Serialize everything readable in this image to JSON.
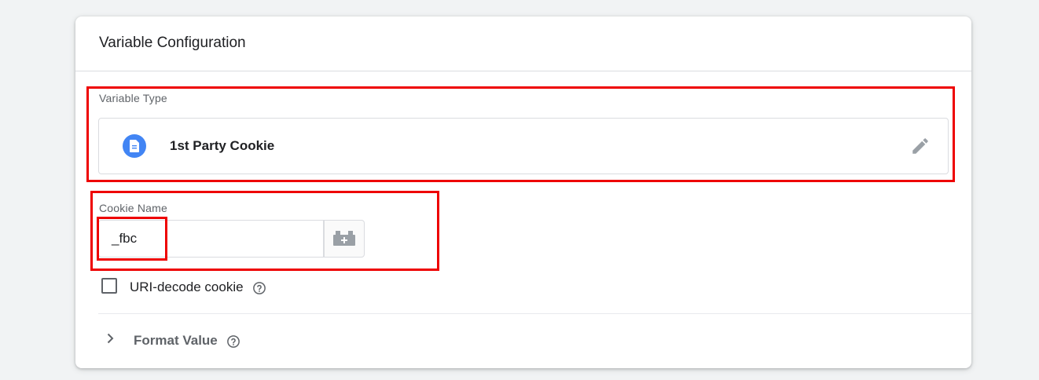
{
  "card": {
    "title": "Variable Configuration"
  },
  "variable_type": {
    "label": "Variable Type",
    "name": "1st Party Cookie",
    "icon": "document-icon",
    "icon_color": "#4285f4"
  },
  "cookie_name": {
    "label": "Cookie Name",
    "value": "_fbc"
  },
  "uri_decode": {
    "label": "URI-decode cookie",
    "checked": false
  },
  "format_value": {
    "label": "Format Value",
    "expanded": false
  },
  "colors": {
    "highlight": "#ee0000",
    "accent": "#4285f4",
    "muted": "#5f6368"
  }
}
